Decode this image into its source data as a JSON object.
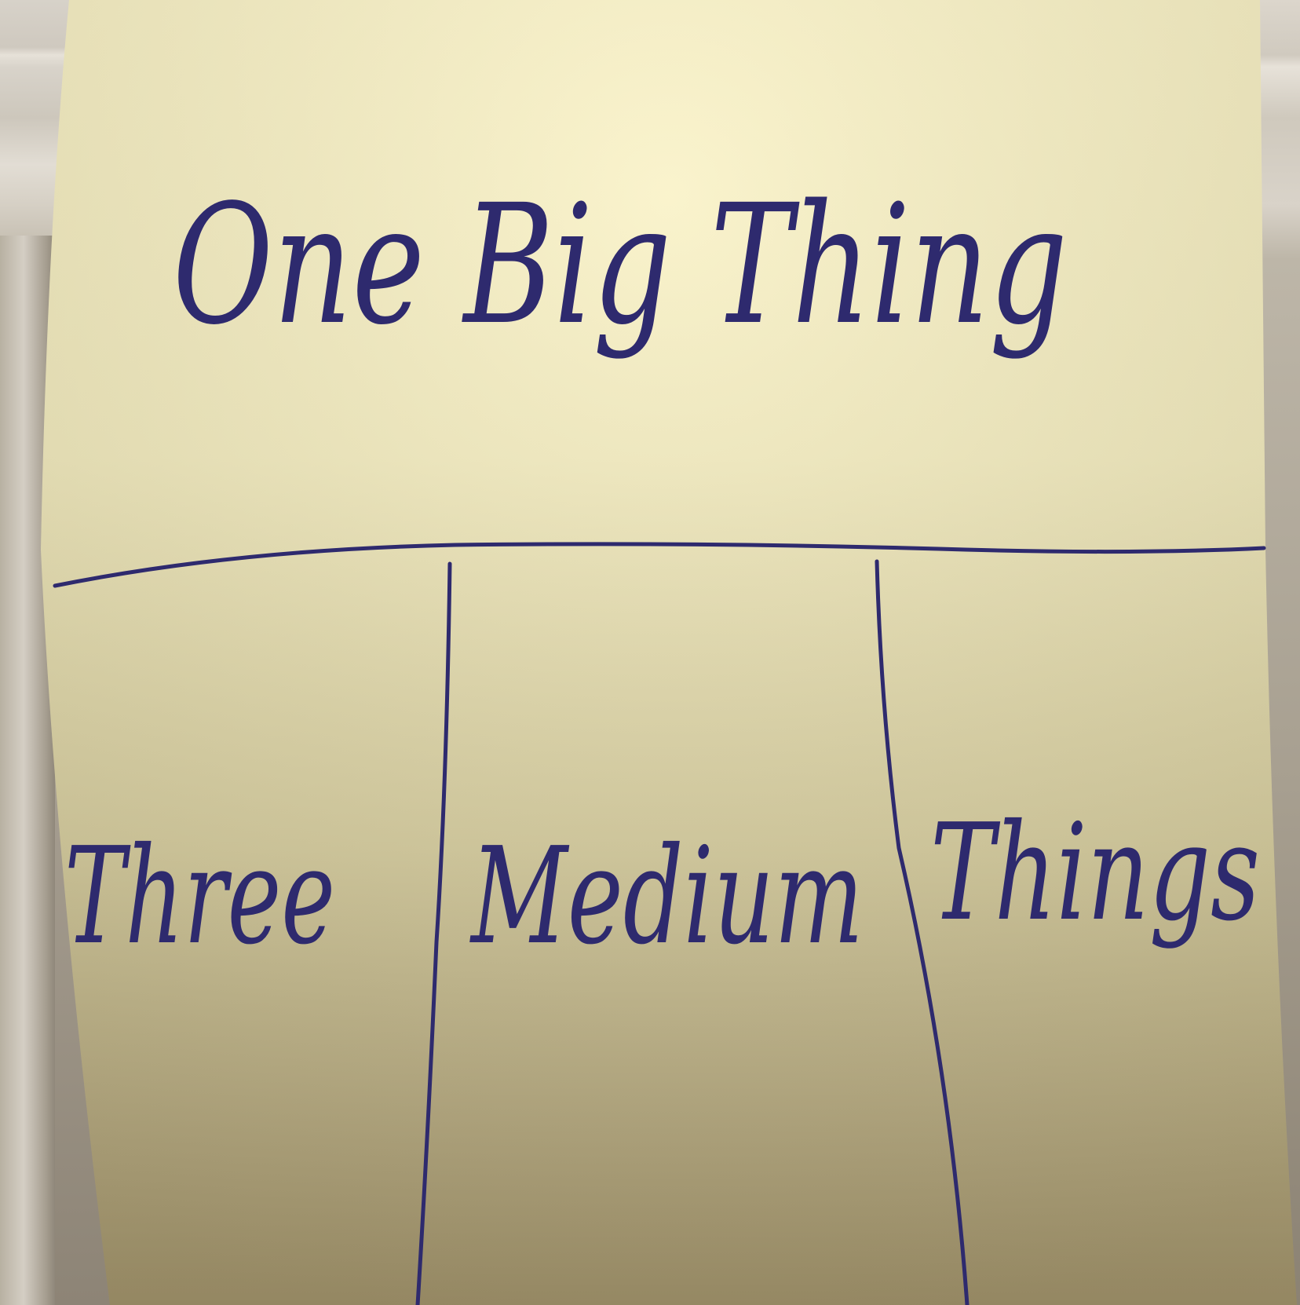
{
  "note": {
    "title": "One Big Thing",
    "columns": [
      {
        "label": "Three"
      },
      {
        "label": "Medium"
      },
      {
        "label": "Things"
      }
    ],
    "paper_color": "#f7efbf",
    "ink_color": "#2e2a6e"
  }
}
